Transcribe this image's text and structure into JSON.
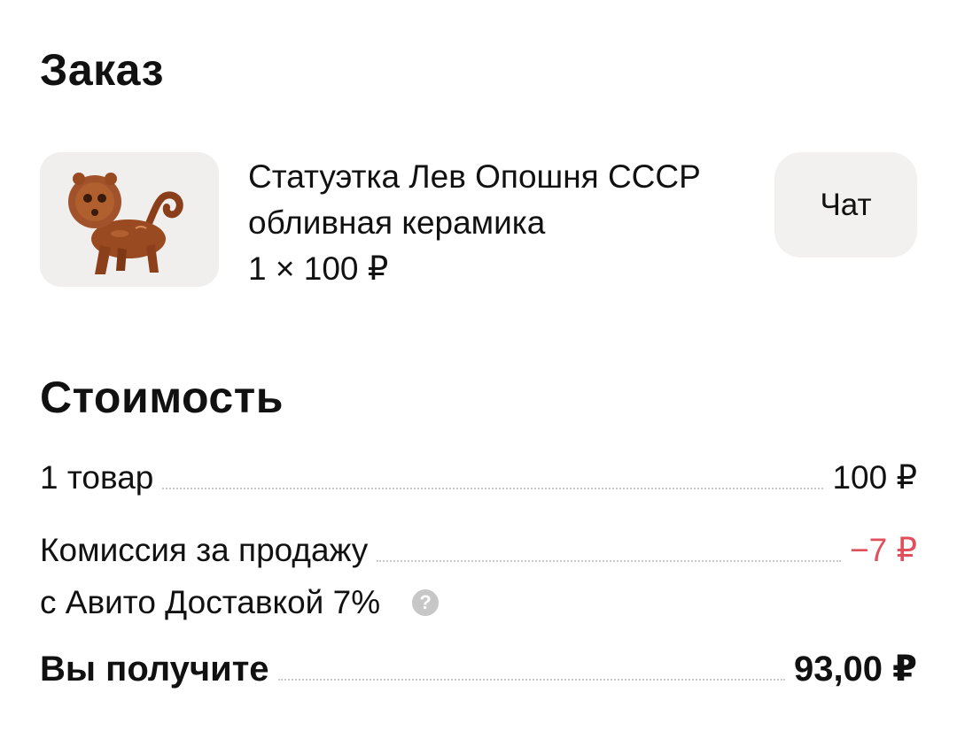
{
  "order": {
    "title": "Заказ",
    "product": {
      "name": "Статуэтка Лев Опошня СССР обливная керамика",
      "quantity_price": "1 × 100 ₽",
      "image_icon": "lion-figurine-photo"
    },
    "chat_label": "Чат"
  },
  "cost": {
    "title": "Стоимость",
    "items_label": "1 товар",
    "items_amount": "100 ₽",
    "fee_label_line1": "Комиссия за продажу",
    "fee_label_line2": "с Авито Доставкой 7%",
    "fee_amount": "−7 ₽",
    "help_icon": "?",
    "total_label": "Вы получите",
    "total_amount": "93,00 ₽"
  },
  "colors": {
    "negative": "#e0505a",
    "button_bg": "#f2f1f0",
    "help_icon_bg": "#c7c7c7"
  }
}
